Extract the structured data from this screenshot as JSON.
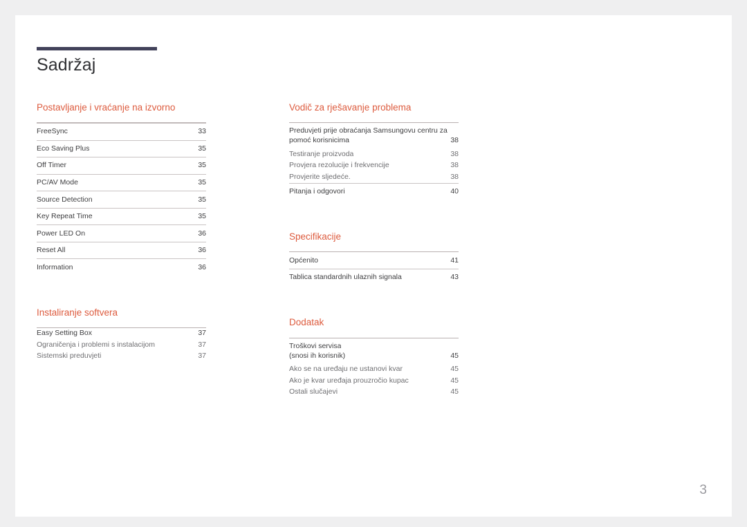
{
  "document": {
    "title": "Sadržaj",
    "page_number": "3",
    "accent_color": "#dd5b3e",
    "rule_color": "#42425a",
    "text_color": "#3d3d3f",
    "sub_text_color": "#6e6e71"
  },
  "columns": {
    "left": [
      {
        "heading": "Postavljanje i vraćanje na izvorno",
        "entries": [
          {
            "label": "FreeSync",
            "page": "33",
            "style": "ruled"
          },
          {
            "label": "Eco Saving Plus",
            "page": "35",
            "style": "ruled"
          },
          {
            "label": "Off Timer",
            "page": "35",
            "style": "ruled"
          },
          {
            "label": "PC/AV Mode",
            "page": "35",
            "style": "ruled"
          },
          {
            "label": "Source Detection",
            "page": "35",
            "style": "ruled"
          },
          {
            "label": "Key Repeat Time",
            "page": "35",
            "style": "ruled"
          },
          {
            "label": "Power LED On",
            "page": "36",
            "style": "ruled"
          },
          {
            "label": "Reset All",
            "page": "36",
            "style": "ruled"
          },
          {
            "label": "Information",
            "page": "36",
            "style": "ruled"
          }
        ]
      },
      {
        "heading": "Instaliranje softvera",
        "entries": [
          {
            "label": "Easy Setting Box",
            "page": "37",
            "style": "main-tight"
          },
          {
            "label": "Ograničenja i problemi s instalacijom",
            "page": "37",
            "style": "sub"
          },
          {
            "label": "Sistemski preduvjeti",
            "page": "37",
            "style": "sub"
          }
        ]
      }
    ],
    "right": [
      {
        "heading": "Vodič za rješavanje problema",
        "entries": [
          {
            "label": "Preduvjeti prije obraćanja Samsungovu centru za",
            "page": "",
            "style": "wrap-first"
          },
          {
            "label": "pomoć korisnicima",
            "page": "38",
            "style": "wrap-second"
          },
          {
            "label": "Testiranje proizvoda",
            "page": "38",
            "style": "sub"
          },
          {
            "label": "Provjera rezolucije i frekvencije",
            "page": "38",
            "style": "sub"
          },
          {
            "label": "Provjerite sljedeće.",
            "page": "38",
            "style": "sub"
          },
          {
            "label": "Pitanja i odgovori",
            "page": "40",
            "style": "ruled"
          }
        ]
      },
      {
        "heading": "Specifikacije",
        "entries": [
          {
            "label": "Općenito",
            "page": "41",
            "style": "plain"
          },
          {
            "label": "Tablica standardnih ulaznih signala",
            "page": "43",
            "style": "ruled"
          }
        ]
      },
      {
        "heading": "Dodatak",
        "entries": [
          {
            "label": "Troškovi servisa",
            "page": "",
            "style": "wrap-first"
          },
          {
            "label": "(snosi ih korisnik)",
            "page": "45",
            "style": "wrap-second"
          },
          {
            "label": "Ako se na uređaju ne ustanovi kvar",
            "page": "45",
            "style": "sub"
          },
          {
            "label": "Ako je kvar uređaja prouzročio kupac",
            "page": "45",
            "style": "sub"
          },
          {
            "label": "Ostali slučajevi",
            "page": "45",
            "style": "sub"
          }
        ]
      }
    ]
  }
}
